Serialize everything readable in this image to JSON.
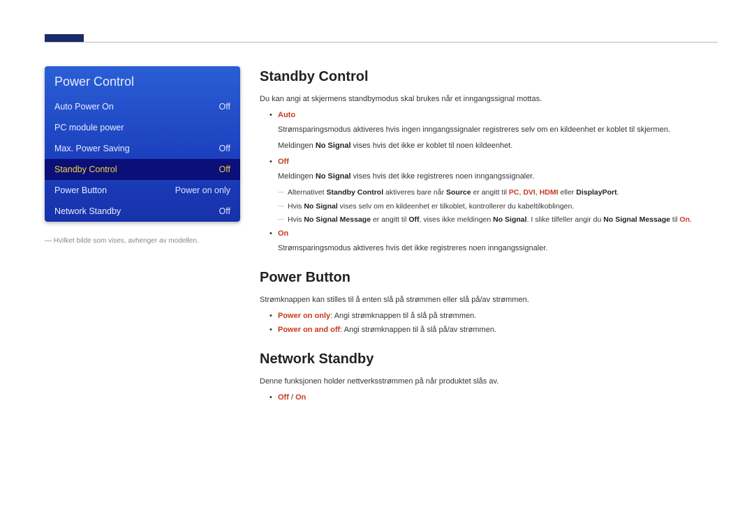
{
  "menu": {
    "title": "Power Control",
    "items": [
      {
        "label": "Auto Power On",
        "value": "Off",
        "selected": false
      },
      {
        "label": "PC module power",
        "value": "",
        "selected": false
      },
      {
        "label": "Max. Power Saving",
        "value": "Off",
        "selected": false
      },
      {
        "label": "Standby Control",
        "value": "Off",
        "selected": true
      },
      {
        "label": "Power Button",
        "value": "Power on only",
        "selected": false
      },
      {
        "label": "Network Standby",
        "value": "Off",
        "selected": false
      }
    ],
    "footnote": "Hvilket bilde som vises, avhenger av modellen."
  },
  "sections": {
    "standby_control": {
      "heading": "Standby Control",
      "intro": "Du kan angi at skjermens standbymodus skal brukes når et inngangssignal mottas.",
      "auto_label": "Auto",
      "auto_line1a": "Strømsparingsmodus aktiveres hvis ingen inngangssignaler registreres selv om en kildeenhet er koblet til skjermen.",
      "auto_line2_pre": "Meldingen ",
      "auto_line2_bold": "No Signal",
      "auto_line2_post": " vises hvis det ikke er koblet til noen kildeenhet.",
      "off_label": "Off",
      "off_line_pre": "Meldingen ",
      "off_line_bold": "No Signal",
      "off_line_post": " vises hvis det ikke registreres noen inngangssignaler.",
      "note1_pre": "Alternativet ",
      "note1_b1": "Standby Control",
      "note1_mid1": " aktiveres bare når ",
      "note1_b2": "Source",
      "note1_mid2": " er angitt til ",
      "note1_em1": "PC",
      "note1_sep1": ", ",
      "note1_em2": "DVI",
      "note1_sep2": ", ",
      "note1_em3": "HDMI",
      "note1_mid3": " eller ",
      "note1_b3": "DisplayPort",
      "note1_end": ".",
      "note2_pre": "Hvis ",
      "note2_b1": "No Signal",
      "note2_post": " vises selv om en kildeenhet er tilkoblet, kontrollerer du kabeltilkoblingen.",
      "note3_pre": "Hvis ",
      "note3_b1": "No Signal Message",
      "note3_mid1": " er angitt til ",
      "note3_b2": "Off",
      "note3_mid2": ", vises ikke meldingen ",
      "note3_b3": "No Signal",
      "note3_mid3": ". I slike tilfeller angir du ",
      "note3_b4": "No Signal Message",
      "note3_mid4": " til ",
      "note3_em": "On",
      "note3_end": ".",
      "on_label": "On",
      "on_line": "Strømsparingsmodus aktiveres hvis det ikke registreres noen inngangssignaler."
    },
    "power_button": {
      "heading": "Power Button",
      "intro": "Strømknappen kan stilles til å enten slå på strømmen eller slå på/av strømmen.",
      "opt1_label": "Power on only",
      "opt1_text": ": Angi strømknappen til å slå på strømmen.",
      "opt2_label": "Power on and off",
      "opt2_text": ": Angi strømknappen til å slå på/av strømmen."
    },
    "network_standby": {
      "heading": "Network Standby",
      "intro": "Denne funksjonen holder nettverksstrømmen på når produktet slås av.",
      "off": "Off",
      "sep": " / ",
      "on": "On"
    }
  }
}
